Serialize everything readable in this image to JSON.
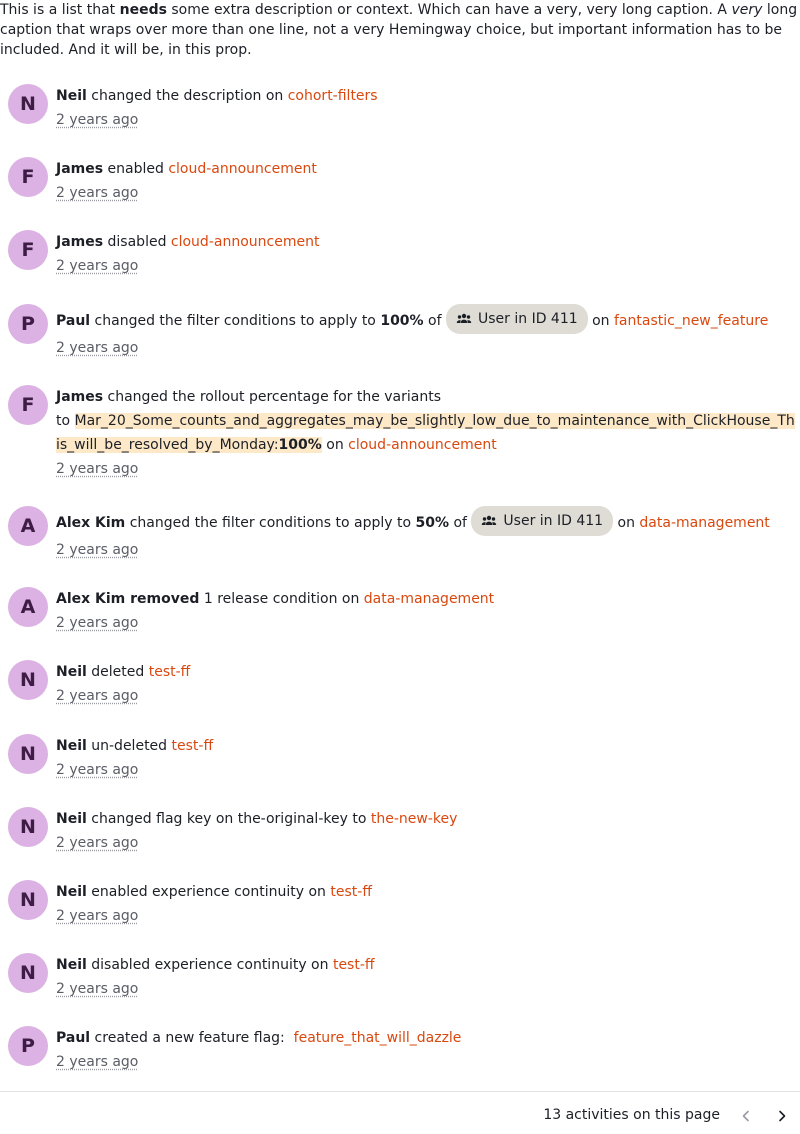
{
  "caption": {
    "p1": "This is a list that ",
    "b1": "needs",
    "p2": " some extra description or context. Which can have a very, very long caption. A ",
    "i1": "very",
    "p3": " long caption that wraps over more than one line, not a very Hemingway choice, but important information has to be included. And it will be, in this prop."
  },
  "activities": [
    {
      "avatar": "N",
      "user": "Neil",
      "text1": " changed the description on ",
      "link": "cohort-filters",
      "time": "2 years ago"
    },
    {
      "avatar": "F",
      "user": "James",
      "text1": " enabled ",
      "link": "cloud-announcement",
      "time": "2 years ago"
    },
    {
      "avatar": "F",
      "user": "James",
      "text1": " disabled ",
      "link": "cloud-announcement",
      "time": "2 years ago"
    },
    {
      "avatar": "P",
      "user": "Paul",
      "text1": " changed the filter conditions to apply to ",
      "percent": "100%",
      "text2": " of ",
      "chip": "User in ID 411",
      "text3": " on ",
      "link": "fantastic_new_feature",
      "time": "2 years ago"
    },
    {
      "avatar": "F",
      "user": "James",
      "text1": " changed the rollout percentage for the variants",
      "text2": "to ",
      "variant": "Mar_20_Some_counts_and_aggregates_may_be_slightly_low_due_to_maintenance_with_ClickHouse_This_will_be_resolved_by_Monday:",
      "percent": "100%",
      "text3": " on ",
      "link": "cloud-announcement",
      "time": "2 years ago"
    },
    {
      "avatar": "A",
      "user": "Alex Kim",
      "text1": " changed the filter conditions to apply to ",
      "percent": "50%",
      "text2": " of ",
      "chip": "User in ID 411",
      "text3": " on ",
      "link": "data-management",
      "time": "2 years ago"
    },
    {
      "avatar": "A",
      "user": "Alex Kim",
      "action": " removed",
      "text1": " 1 release condition on ",
      "link": "data-management",
      "time": "2 years ago"
    },
    {
      "avatar": "N",
      "user": "Neil",
      "text1": " deleted ",
      "link": "test-ff",
      "time": "2 years ago"
    },
    {
      "avatar": "N",
      "user": "Neil",
      "text1": " un-deleted ",
      "link": "test-ff",
      "time": "2 years ago"
    },
    {
      "avatar": "N",
      "user": "Neil",
      "text1": " changed flag key on the-original-key to ",
      "link": "the-new-key",
      "time": "2 years ago"
    },
    {
      "avatar": "N",
      "user": "Neil",
      "text1": " enabled experience continuity on ",
      "link": "test-ff",
      "time": "2 years ago"
    },
    {
      "avatar": "N",
      "user": "Neil",
      "text1": " disabled experience continuity on ",
      "link": "test-ff",
      "time": "2 years ago"
    },
    {
      "avatar": "P",
      "user": "Paul",
      "text1": " created a new feature flag:  ",
      "link": "feature_that_will_dazzle",
      "time": "2 years ago"
    }
  ],
  "footer": {
    "count_label": "13 activities on this page",
    "prev_icon": "chevron-left-icon",
    "next_icon": "chevron-right-icon"
  },
  "colors": {
    "avatar_bg": "#dcb1e3",
    "link": "#d9480f",
    "chip_bg": "#dedcd4",
    "highlight": "#fde9c7"
  }
}
